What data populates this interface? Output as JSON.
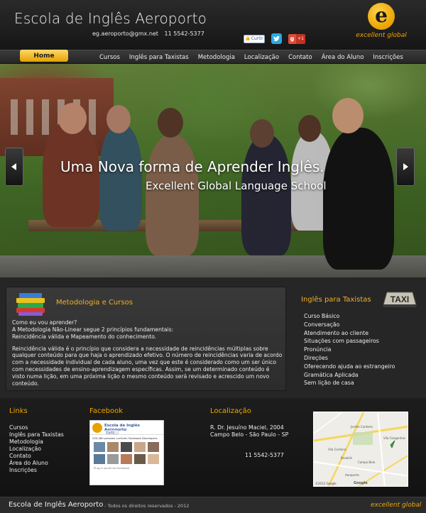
{
  "header": {
    "site_title": "Escola de Inglês Aeroporto",
    "email": "eg.aeroporto@gmx.net",
    "phone": "11 5542-5377",
    "social": {
      "like_label": "Curtir",
      "gplus_label": "+1"
    },
    "brand": {
      "logo_letter": "e",
      "name": "excellent global",
      "accent_color": "#f0a500"
    }
  },
  "nav": {
    "home": "Home",
    "items": [
      "Cursos",
      "Inglês para Taxistas",
      "Metodologia",
      "Localização",
      "Contato",
      "Área do Aluno",
      "Inscrições"
    ]
  },
  "hero": {
    "title": "Uma Nova forma de Aprender Inglês.",
    "subtitle": "Excellent Global Language School",
    "prev_icon": "chevron-left-icon",
    "next_icon": "chevron-right-icon"
  },
  "metodologia": {
    "title": "Metodologia e Cursos",
    "lines": [
      "Como eu vou aprender?",
      "A Metodologia Não-Linear segue 2 princípios fundamentais:",
      "Reincidência válida e  Mapeamento do conhecimento."
    ],
    "paragraph": "Reincidência válida é o princípio que considera a necessidade de reincidências múltiplas sobre qualquer conteúdo para que haja o aprendizado efetivo. O número de reincidências varia de acordo com a necessidade individual de cada aluno, uma vez que este é considerado como um ser único com necessidades de ensino-aprendizagem específicas. Assim, se um determinado conteúdo é visto numa lição, em uma próxima lição o mesmo conteúdo será revisado e acrescido um novo conteúdo."
  },
  "taxistas": {
    "title": "Inglês para Taxistas",
    "sign_text": "TAXI",
    "items": [
      "Curso Básico",
      "Conversação",
      "Atendimento ao cliente",
      "Situações com passageiros",
      "Pronúncia",
      "Direções",
      "Oferecendo ajuda ao estrangeiro",
      "Gramática Aplicada",
      "Sem lição de casa"
    ]
  },
  "footer": {
    "links_title": "Links",
    "links": [
      "Cursos",
      "Inglês para Taxistas",
      "Metodologia",
      "Localização",
      "Contato",
      "Área do Aluno",
      "Inscrições"
    ],
    "facebook_title": "Facebook",
    "facebook": {
      "page_name": "Escola de Inglês Aeroporto",
      "like_label": "Curtir",
      "count_text": "230,460 pessoas curtiram Facebook Developers.",
      "plugin_text": "Plug-in social do Facebook"
    },
    "localizacao_title": "Localização",
    "address_line1": "R. Dr. Jesuíno Maciel, 2004",
    "address_line2": "Campo Belo - São Paulo - SP",
    "phone": "11 5542-5377",
    "map": {
      "labels": [
        "Jardim Cordeiro",
        "Vila Congonhas",
        "Vila Cordeiro",
        "Brooklin",
        "Campo Belo",
        "Aeroporto"
      ],
      "copyright": "©2012 Google",
      "google": "Google"
    }
  },
  "bottom": {
    "title": "Escola de Inglês Aeroporto",
    "rights": "- Todos os direitos reservados - 2012",
    "brand": "excellent global"
  }
}
